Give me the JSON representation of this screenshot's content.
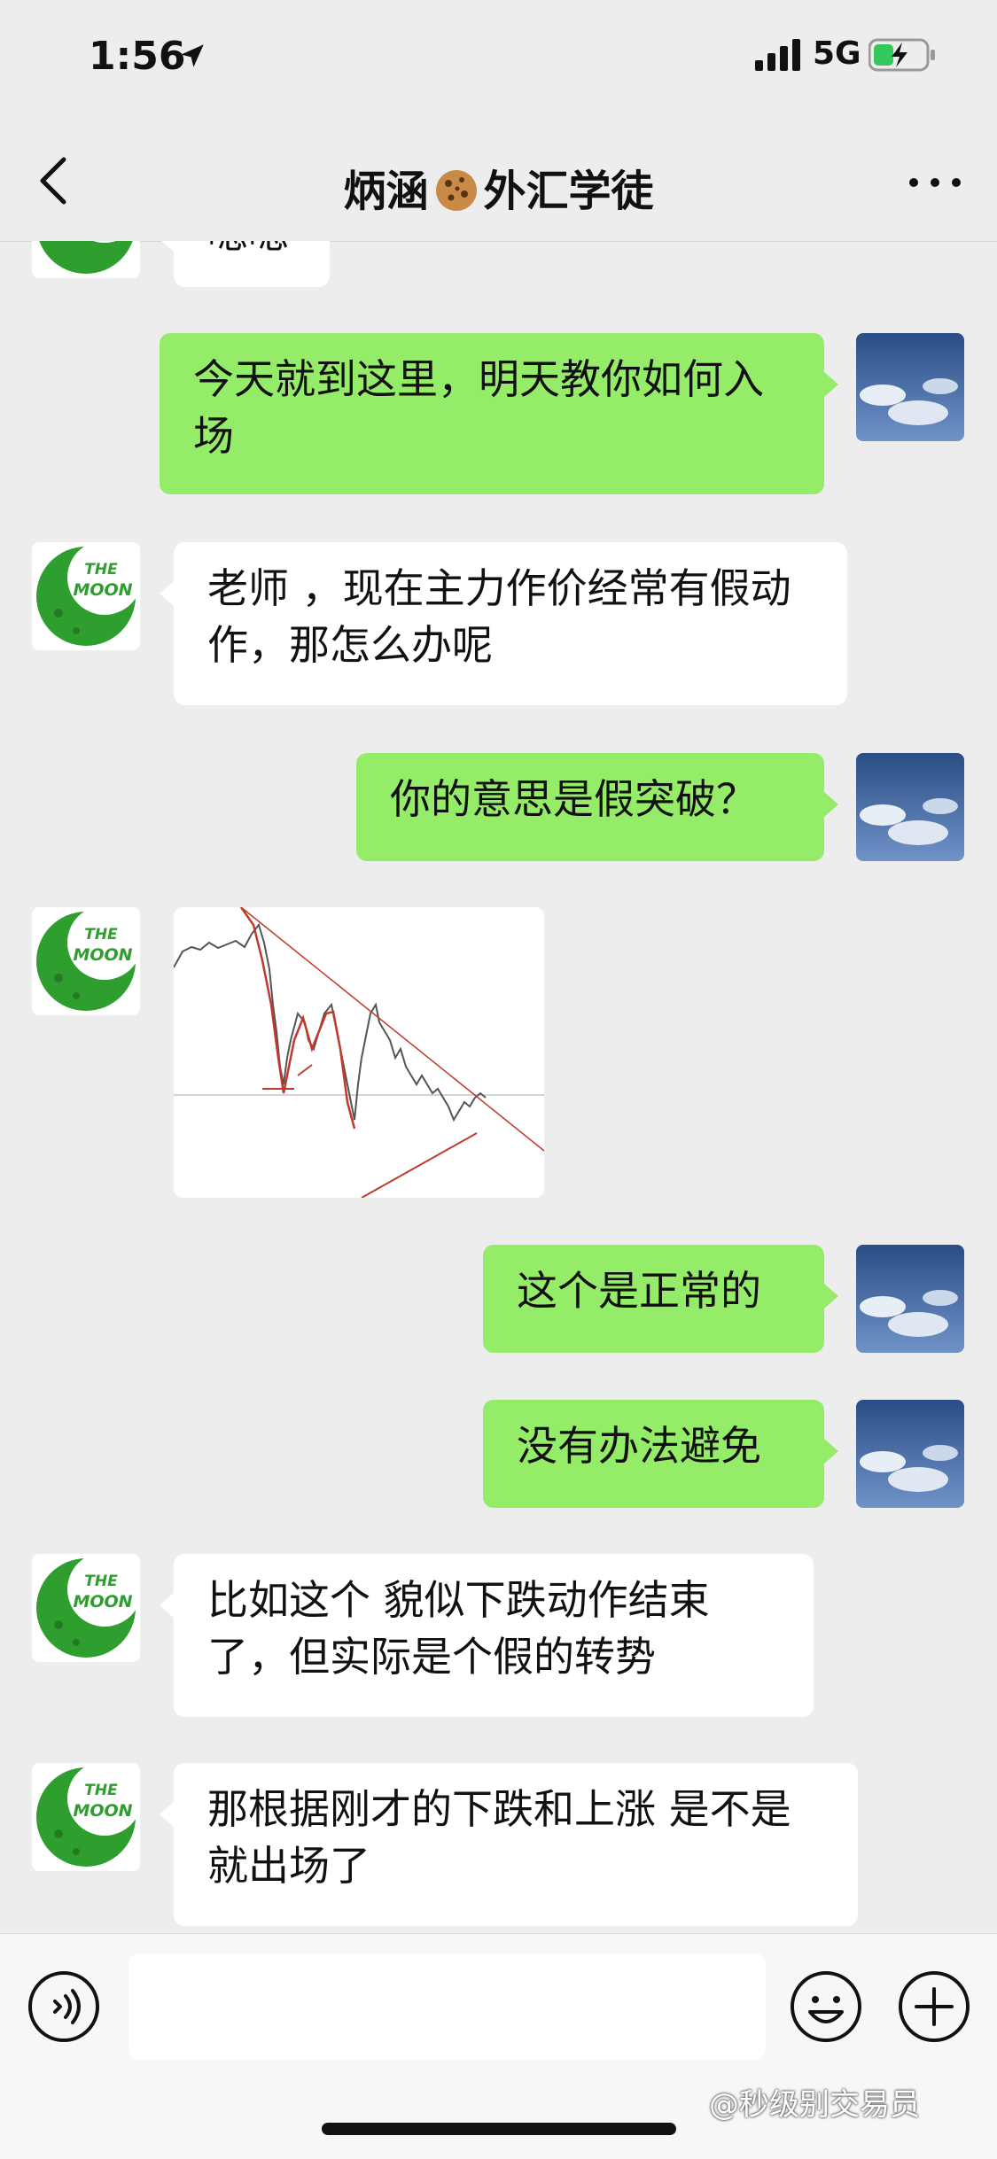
{
  "status_bar": {
    "time": "1:56",
    "network": "5G"
  },
  "header": {
    "back_label": "back",
    "title_left": "炳涵",
    "title_right": "外汇学徒",
    "more_label": "more"
  },
  "avatars": {
    "friend_text_1": "THE",
    "friend_text_2": "MOON"
  },
  "messages": [
    {
      "side": "left",
      "text": "嗯嗯"
    },
    {
      "side": "right",
      "text": "今天就到这里，明天教你如何入场"
    },
    {
      "side": "left",
      "text": "老师 ，现在主力作价经常有假动作，那怎么办呢"
    },
    {
      "side": "right",
      "text": "你的意思是假突破？"
    },
    {
      "side": "left",
      "type": "image",
      "alt": "chart"
    },
    {
      "side": "right",
      "text": "这个是正常的"
    },
    {
      "side": "right",
      "text": "没有办法避免"
    },
    {
      "side": "left",
      "text": "比如这个  貌似下跌动作结束了，但实际是个假的转势"
    },
    {
      "side": "left",
      "text": "那根据刚才的下跌和上涨  是不是就出场了"
    }
  ],
  "input": {
    "placeholder": ""
  },
  "watermark": "@秒级别交易员"
}
